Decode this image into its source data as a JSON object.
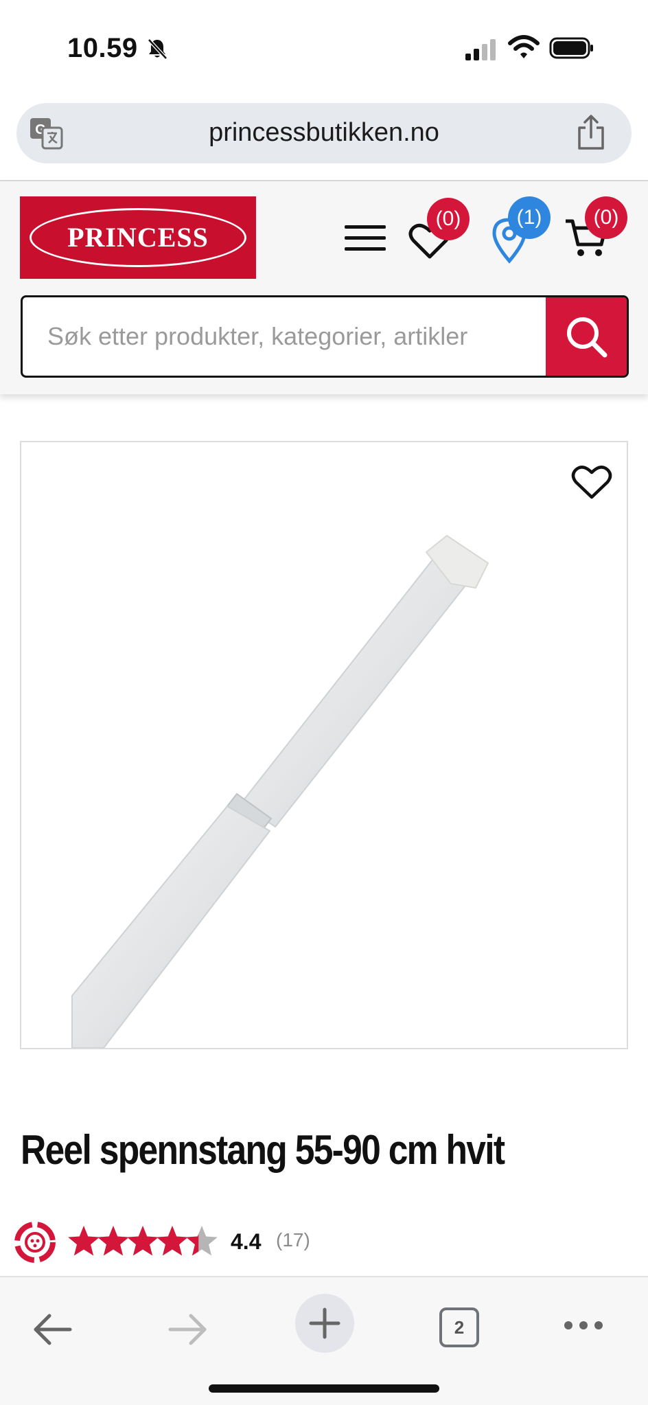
{
  "status_bar": {
    "time": "10.59"
  },
  "browser": {
    "url": "princessbutikken.no"
  },
  "header": {
    "logo_text": "PRINCESS",
    "badges": {
      "wishlist": "(0)",
      "stores": "(1)",
      "cart": "(0)"
    },
    "search": {
      "placeholder": "Søk etter produkter, kategorier, artikler"
    }
  },
  "product": {
    "title": "Reel spennstang 55-90 cm hvit",
    "rating_value": "4.4",
    "rating_count": "(17)",
    "rating_stars": 4.4
  },
  "toolbar": {
    "tab_count": "2"
  },
  "colors": {
    "brand_red": "#c8102e",
    "badge_red": "#d4163a",
    "badge_blue": "#2f86de"
  }
}
